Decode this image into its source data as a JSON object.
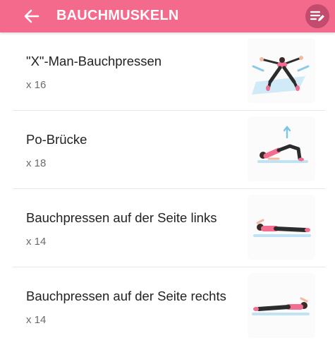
{
  "appbar": {
    "back_icon": "arrow-left-icon",
    "title": "BAUCHMUSKELN",
    "edit_icon": "edit-list-icon",
    "color": "#f46a8c"
  },
  "exercises": [
    {
      "name": "\"X\"-Man-Bauchpressen",
      "reps": "x 16",
      "icon": "x-man-crunch-illustration"
    },
    {
      "name": "Po-Brücke",
      "reps": "x 18",
      "icon": "glute-bridge-illustration"
    },
    {
      "name": "Bauchpressen auf der Seite links",
      "reps": "x 14",
      "icon": "side-crunch-left-illustration"
    },
    {
      "name": "Bauchpressen auf der Seite rechts",
      "reps": "x 14",
      "icon": "side-crunch-right-illustration"
    }
  ]
}
